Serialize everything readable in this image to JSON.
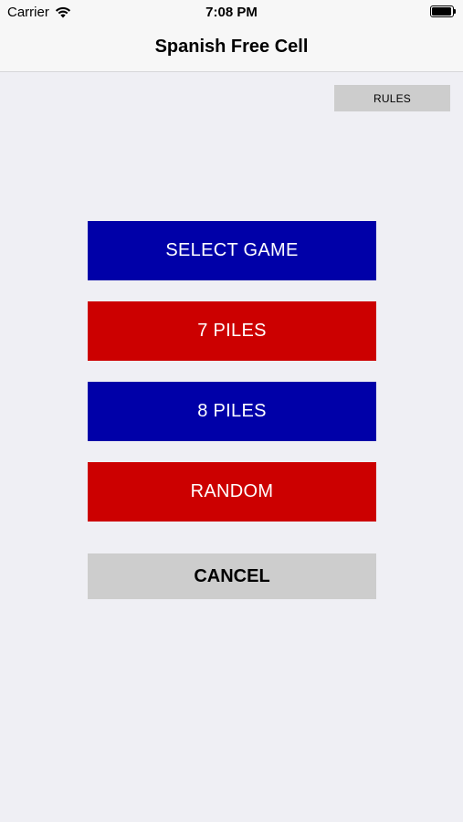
{
  "status_bar": {
    "carrier": "Carrier",
    "time": "7:08 PM",
    "wifi_icon": "wifi-icon",
    "battery_icon": "battery-icon"
  },
  "nav": {
    "title": "Spanish Free Cell"
  },
  "rules_label": "RULES",
  "menu": {
    "select_game": "SELECT GAME",
    "seven_piles": "7 PILES",
    "eight_piles": "8 PILES",
    "random": "RANDOM",
    "cancel": "CANCEL"
  },
  "colors": {
    "background": "#efeff4",
    "blue_button": "#0000a8",
    "red_button": "#cc0000",
    "gray_button": "#cdcdcd"
  }
}
